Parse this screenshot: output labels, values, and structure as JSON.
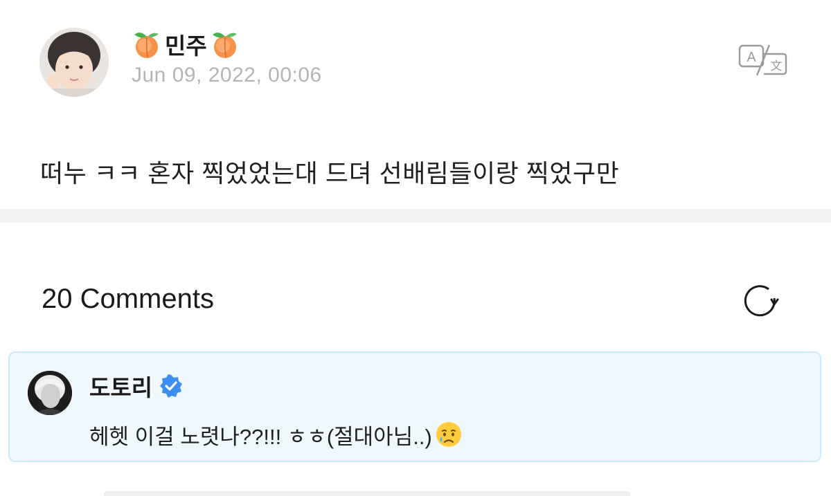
{
  "post": {
    "author": {
      "name": "민주",
      "name_prefix_icon": "peach-emoji",
      "name_suffix_icon": "peach-emoji",
      "avatar": "author-avatar-photo"
    },
    "date": "Jun 09, 2022, 00:06",
    "body": "떠누 ㅋㅋ 혼자 찍었었는대 드뎌 선배림들이랑 찍었구만",
    "translate_icon": "translate-icon"
  },
  "comments": {
    "count_label": "20 Comments",
    "refresh_icon": "refresh-icon",
    "items": [
      {
        "author": "도토리",
        "verified": true,
        "verified_icon": "verified-badge-icon",
        "avatar": "commenter-avatar-photo",
        "text": "헤헷 이걸 노렷나??!!! ㅎㅎ(절대아님..)",
        "trailing_emoji": "crying-face-emoji"
      }
    ]
  },
  "colors": {
    "date_gray": "#b4b4b4",
    "divider": "#f2f3f5",
    "comment_bg": "#eef8fd",
    "comment_border": "#c9e9f6",
    "verified_blue": "#3d8ef0"
  }
}
